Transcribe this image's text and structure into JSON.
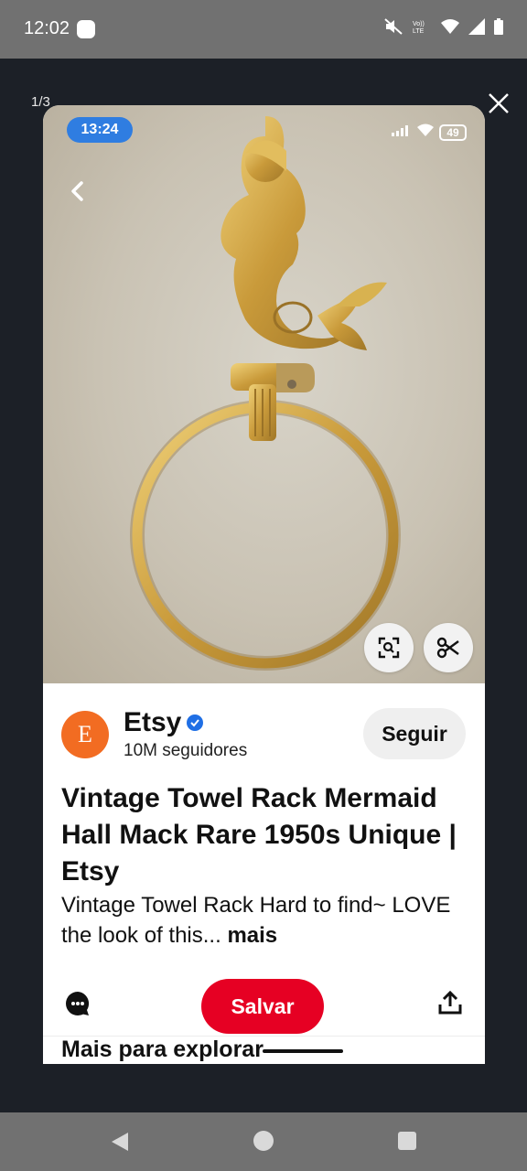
{
  "status_bar": {
    "time": "12:02",
    "icons": [
      "mute-icon",
      "volte-icon",
      "wifi-icon",
      "signal-icon",
      "battery-icon"
    ],
    "volte_label": "Vo))\nLTE"
  },
  "viewer": {
    "page_counter": "1/3",
    "close_icon": "close-icon"
  },
  "screenshot": {
    "status_time": "13:24",
    "battery": "49",
    "colors": {
      "time_pill": "#2f7de1",
      "save": "#e60023",
      "avatar": "#f26c22"
    },
    "pin": {
      "avatar_letter": "E",
      "brand": "Etsy",
      "followers": "10M seguidores",
      "follow_label": "Seguir",
      "title": "Vintage Towel Rack Mermaid Hall Mack Rare 1950s Unique | Etsy",
      "description": "Vintage Towel Rack Hard to find~ LOVE the look of this...",
      "more_label": "mais",
      "save_label": "Salvar",
      "explore_label": "Mais para explorar"
    }
  },
  "nav_bar": {
    "buttons": [
      "back-icon",
      "home-icon",
      "recents-icon"
    ]
  }
}
